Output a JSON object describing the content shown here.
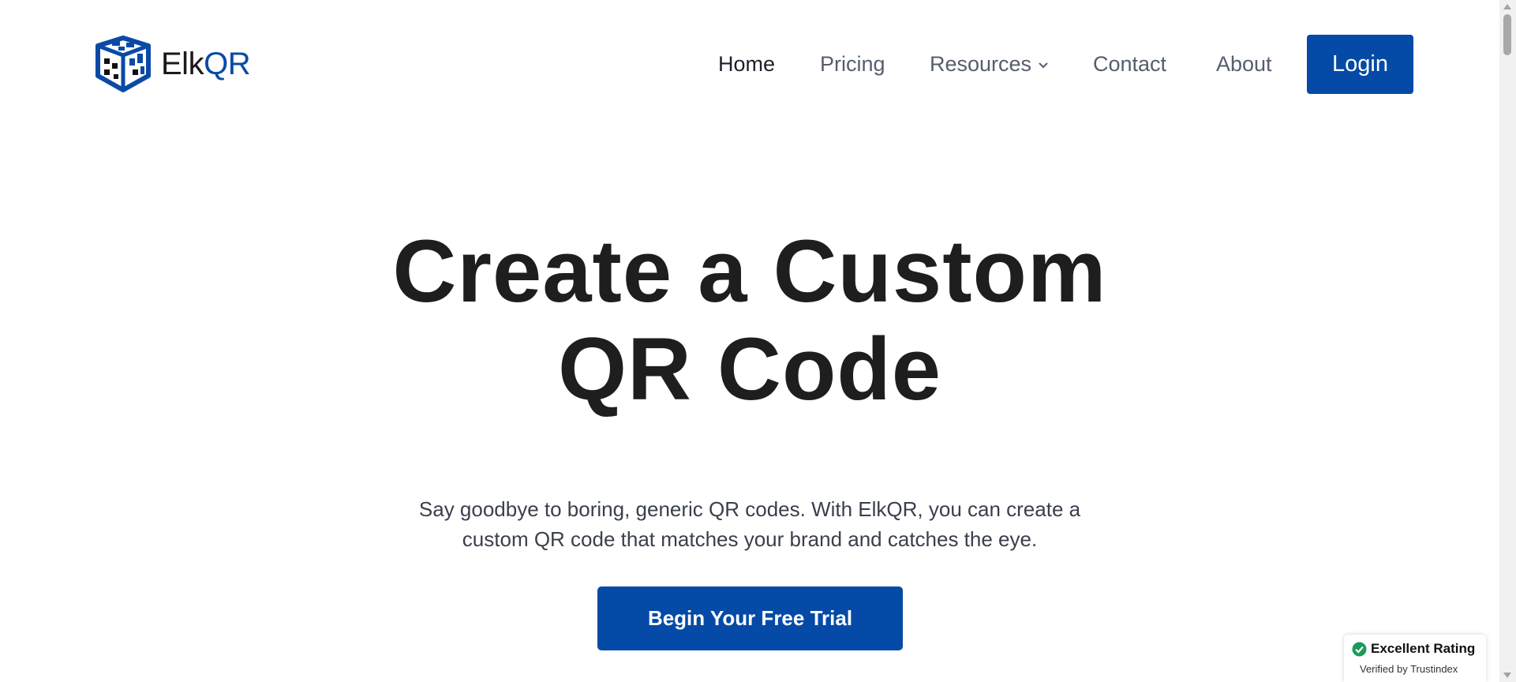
{
  "brand": {
    "name_part1": "Elk",
    "name_part2": "QR",
    "logo_icon": "qr-cube-icon",
    "accent_color": "#054aa6"
  },
  "nav": {
    "items": [
      {
        "label": "Home",
        "active": true
      },
      {
        "label": "Pricing"
      },
      {
        "label": "Resources",
        "icon": "chevron-down-icon"
      },
      {
        "label": "Contact"
      },
      {
        "label": "About"
      }
    ],
    "login_label": "Login"
  },
  "hero": {
    "title_line1": "Create a Custom",
    "title_line2": "QR Code",
    "subtitle_line1": "Say goodbye to boring, generic QR codes. With ElkQR, you can create a",
    "subtitle_line2": "custom QR code that matches your brand and catches the eye.",
    "cta_label": "Begin Your Free Trial"
  },
  "badge": {
    "icon": "check-circle-icon",
    "title": "Excellent Rating",
    "subtitle": "Verified by Trustindex",
    "icon_color": "#1b9a59"
  }
}
